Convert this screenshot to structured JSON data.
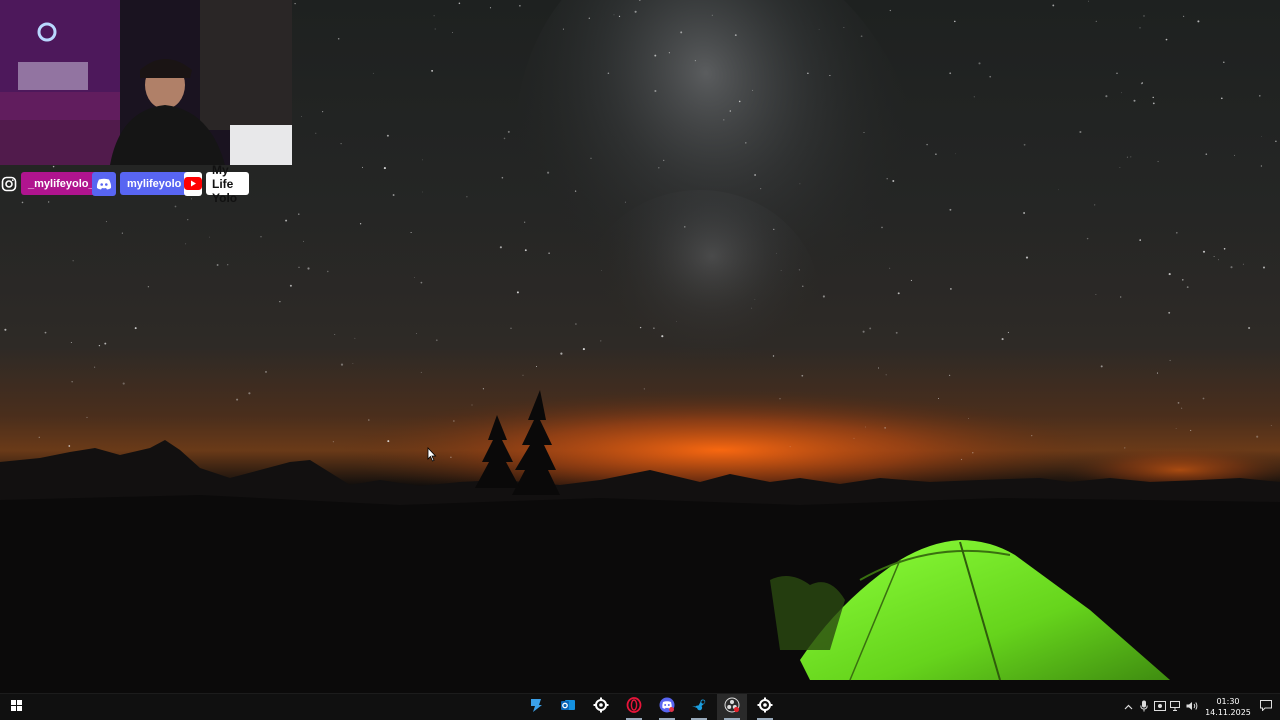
{
  "stream_overlay": {
    "socials": [
      {
        "platform": "instagram",
        "handle": "_mylifeyolo_",
        "icon": "instagram-icon",
        "color": "#b0148f"
      },
      {
        "platform": "discord",
        "handle": "mylifeyolo",
        "icon": "discord-icon",
        "color": "#5865f2"
      },
      {
        "platform": "youtube",
        "handle": "My Life Yolo",
        "icon": "youtube-icon",
        "color": "#ff0000"
      }
    ]
  },
  "taskbar": {
    "apps": [
      {
        "name": "reader-app",
        "icon": "reader-icon"
      },
      {
        "name": "outlook",
        "icon": "outlook-icon"
      },
      {
        "name": "steelseries-gg",
        "icon": "steelseries-icon"
      },
      {
        "name": "opera-gx",
        "icon": "opera-icon"
      },
      {
        "name": "discord",
        "icon": "discord-icon"
      },
      {
        "name": "steam",
        "icon": "steam-icon"
      },
      {
        "name": "obs-studio",
        "icon": "obs-icon"
      },
      {
        "name": "steelseries-engine",
        "icon": "steelseries-icon"
      }
    ],
    "clock": {
      "time": "01:30",
      "date": "14.11.2025"
    }
  }
}
